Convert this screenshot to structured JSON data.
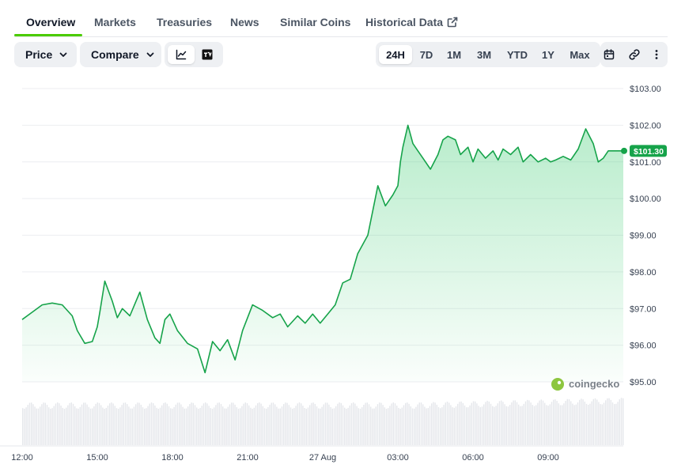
{
  "tabs": [
    {
      "label": "Overview",
      "active": true
    },
    {
      "label": "Markets"
    },
    {
      "label": "Treasuries"
    },
    {
      "label": "News"
    },
    {
      "label": "Similar Coins"
    },
    {
      "label": "Historical Data",
      "icon": "external-link-icon"
    }
  ],
  "toolbar": {
    "price_label": "Price",
    "compare_label": "Compare",
    "chart_type_options": [
      "line-chart-icon",
      "tradingview-icon"
    ],
    "chart_type_selected": "line-chart-icon",
    "ranges": [
      "24H",
      "7D",
      "1M",
      "3M",
      "YTD",
      "1Y",
      "Max"
    ],
    "range_selected": "24H",
    "extra_icons": [
      "calendar-icon",
      "link-icon",
      "more-vertical-icon"
    ]
  },
  "colors": {
    "accent": "#4bcc00",
    "line": "#16a34a",
    "badge": "#16a34a",
    "volume": "#e5e7eb"
  },
  "watermark": "coingecko",
  "chart_data": {
    "type": "area",
    "x_ticks": [
      "12:00",
      "15:00",
      "18:00",
      "21:00",
      "27 Aug",
      "03:00",
      "06:00",
      "09:00"
    ],
    "y_ticks": [
      "$103.00",
      "$102.00",
      "$101.00",
      "$100.00",
      "$99.00",
      "$98.00",
      "$97.00",
      "$96.00",
      "$95.00"
    ],
    "ylim": [
      95,
      103
    ],
    "x_hours": [
      0,
      24
    ],
    "last_price_label": "$101.30",
    "grid": true,
    "series": [
      {
        "x": [
          0,
          0.4,
          0.8,
          1.2,
          1.6,
          2.0,
          2.2,
          2.5,
          2.8,
          3.0,
          3.1,
          3.3,
          3.6,
          3.8,
          4.0,
          4.3,
          4.7,
          5.0,
          5.3,
          5.5,
          5.7,
          5.9,
          6.2,
          6.6,
          7.0,
          7.3,
          7.6,
          7.9,
          8.2,
          8.5,
          8.8,
          9.2,
          9.6,
          10.0,
          10.3,
          10.6,
          11.0,
          11.3,
          11.6,
          11.9,
          12.2,
          12.5,
          12.8,
          13.1,
          13.4,
          13.8,
          14.2,
          14.5,
          14.8,
          15.0,
          15.1,
          15.2,
          15.4,
          15.6,
          15.8,
          16.0,
          16.3,
          16.6,
          16.8,
          17.0,
          17.3,
          17.5,
          17.8,
          18.0,
          18.2,
          18.5,
          18.8,
          19.0,
          19.2,
          19.5,
          19.8,
          20.0,
          20.3,
          20.6,
          20.9,
          21.1,
          21.3,
          21.6,
          21.9,
          22.2,
          22.5,
          22.8,
          23.0,
          23.2,
          23.4,
          23.6,
          23.8,
          24.0
        ],
        "values": [
          96.7,
          96.9,
          97.1,
          97.15,
          97.1,
          96.8,
          96.4,
          96.05,
          96.1,
          96.5,
          96.9,
          97.75,
          97.2,
          96.75,
          97.0,
          96.8,
          97.45,
          96.7,
          96.2,
          96.05,
          96.7,
          96.85,
          96.4,
          96.05,
          95.9,
          95.25,
          96.1,
          95.85,
          96.15,
          95.6,
          96.4,
          97.1,
          96.95,
          96.75,
          96.85,
          96.5,
          96.8,
          96.6,
          96.85,
          96.6,
          96.85,
          97.1,
          97.7,
          97.8,
          98.5,
          99.0,
          100.35,
          99.8,
          100.1,
          100.35,
          101.0,
          101.4,
          102.0,
          101.5,
          101.3,
          101.1,
          100.8,
          101.2,
          101.6,
          101.7,
          101.6,
          101.2,
          101.4,
          101.0,
          101.35,
          101.1,
          101.3,
          101.05,
          101.35,
          101.2,
          101.4,
          101.0,
          101.2,
          101.0,
          101.1,
          101.0,
          101.05,
          101.15,
          101.05,
          101.35,
          101.9,
          101.5,
          101.0,
          101.1,
          101.3,
          101.3,
          101.3,
          101.3
        ]
      }
    ]
  }
}
